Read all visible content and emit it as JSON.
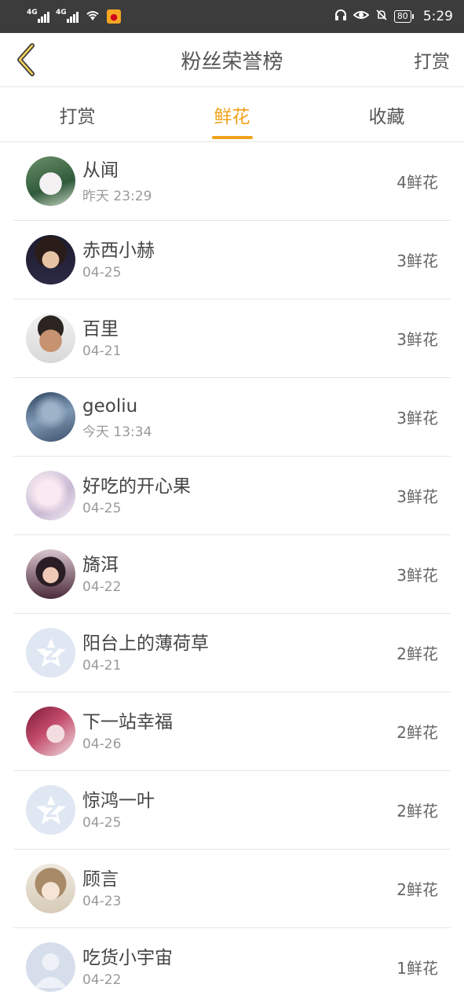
{
  "status": {
    "net1": "4G",
    "net2": "4G",
    "battery": "80",
    "time": "5:29"
  },
  "header": {
    "title": "粉丝荣誉榜",
    "action": "打赏"
  },
  "tabs": [
    {
      "label": "打赏",
      "active": false
    },
    {
      "label": "鲜花",
      "active": true
    },
    {
      "label": "收藏",
      "active": false
    }
  ],
  "colors": {
    "accent": "#f0a21c",
    "status_bar": "#3c3c3c"
  },
  "fans": [
    {
      "name": "从闻",
      "date": "昨天 23:29",
      "count": "4鲜花",
      "avatar": "photo-avatar-wedding"
    },
    {
      "name": "赤西小赫",
      "date": "04-25",
      "count": "3鲜花",
      "avatar": "photo-avatar-boy"
    },
    {
      "name": "百里",
      "date": "04-21",
      "count": "3鲜花",
      "avatar": "photo-avatar-man"
    },
    {
      "name": "geoliu",
      "date": "今天 13:34",
      "count": "3鲜花",
      "avatar": "photo-avatar-ship"
    },
    {
      "name": "好吃的开心果",
      "date": "04-25",
      "count": "3鲜花",
      "avatar": "photo-avatar-anime-white"
    },
    {
      "name": "旖洱",
      "date": "04-22",
      "count": "3鲜花",
      "avatar": "photo-avatar-girl"
    },
    {
      "name": "阳台上的薄荷草",
      "date": "04-21",
      "count": "2鲜花",
      "avatar": "default-qq-star-icon"
    },
    {
      "name": "下一站幸福",
      "date": "04-26",
      "count": "2鲜花",
      "avatar": "photo-avatar-anime-red"
    },
    {
      "name": "惊鸿一叶",
      "date": "04-25",
      "count": "2鲜花",
      "avatar": "default-qq-star-icon"
    },
    {
      "name": "顾言",
      "date": "04-23",
      "count": "2鲜花",
      "avatar": "photo-avatar-anime-doll"
    },
    {
      "name": "吃货小宇宙",
      "date": "04-22",
      "count": "1鲜花",
      "avatar": "default-person-icon"
    }
  ]
}
